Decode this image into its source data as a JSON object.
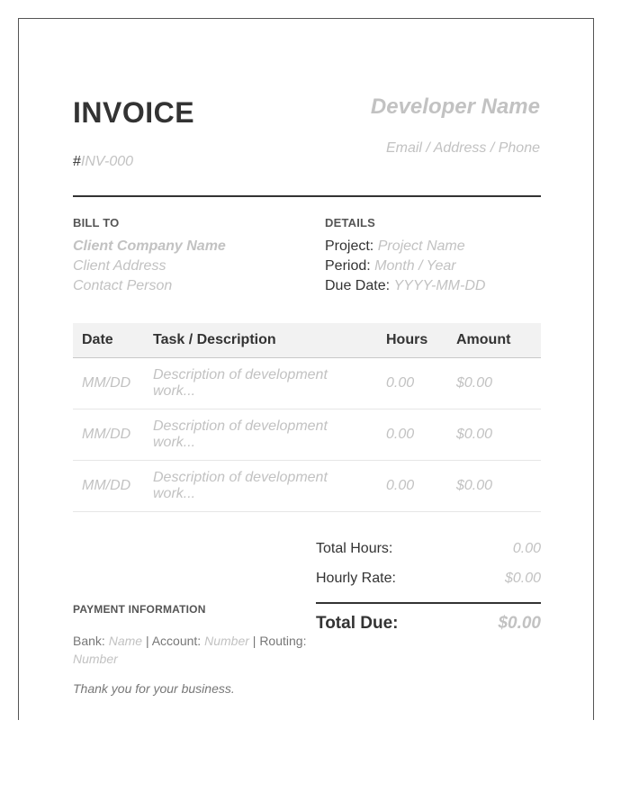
{
  "header": {
    "title": "INVOICE",
    "number_prefix": "#",
    "number_placeholder": "INV-000",
    "developer_name": "Developer Name",
    "developer_contact": "Email / Address / Phone"
  },
  "bill_to": {
    "label": "BILL TO",
    "company": "Client Company Name",
    "address": "Client Address",
    "contact": "Contact Person"
  },
  "details": {
    "label": "DETAILS",
    "project_label": "Project:",
    "project_value": "Project Name",
    "period_label": "Period:",
    "period_value": "Month / Year",
    "due_label": "Due Date:",
    "due_value": "YYYY-MM-DD"
  },
  "table": {
    "headers": [
      "Date",
      "Task / Description",
      "Hours",
      "Amount"
    ],
    "rows": [
      [
        "MM/DD",
        "Description of development work...",
        "0.00",
        "$0.00"
      ],
      [
        "MM/DD",
        "Description of development work...",
        "0.00",
        "$0.00"
      ],
      [
        "MM/DD",
        "Description of development work...",
        "0.00",
        "$0.00"
      ]
    ]
  },
  "totals": {
    "hours_label": "Total Hours:",
    "hours_value": "0.00",
    "rate_label": "Hourly Rate:",
    "rate_value": "$0.00",
    "due_label": "Total Due:",
    "due_value": "$0.00"
  },
  "payment": {
    "label": "PAYMENT INFORMATION",
    "bank_label": "Bank:",
    "bank_value": "Name",
    "account_label": "Account:",
    "account_value": "Number",
    "routing_label": "Routing:",
    "routing_value": "Number",
    "separator": "|",
    "thanks": "Thank you for your business."
  }
}
